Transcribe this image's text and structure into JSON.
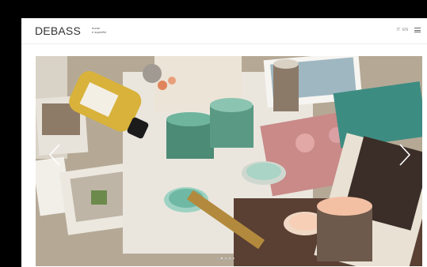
{
  "brand": {
    "logo": "DEBASS",
    "tagline_line1": "home",
    "tagline_line2": "e superfici"
  },
  "header": {
    "lang_current": "IT",
    "lang_other": "EN",
    "menu_icon": "hamburger-icon"
  },
  "hero": {
    "slide_count": 4,
    "active_slide": 1,
    "prev_icon": "chevron-left-icon",
    "next_icon": "chevron-right-icon"
  },
  "footer": {
    "caption": "scroll down"
  }
}
